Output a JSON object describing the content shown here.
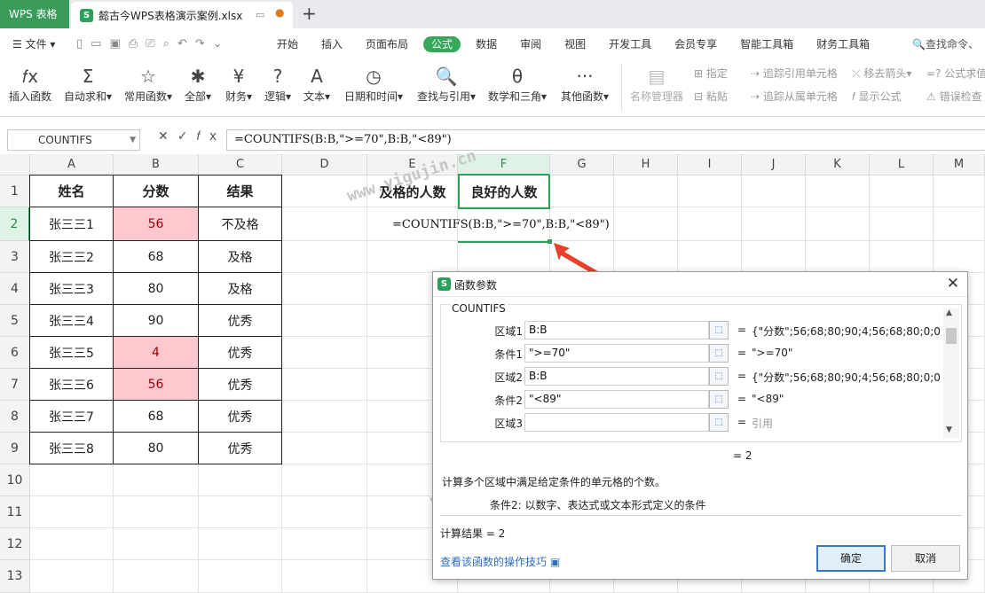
{
  "titlebar": {
    "app_tab": "WPS 表格",
    "doc_tab": "懿古今WPS表格演示案例.xlsx",
    "doc_icon": "S",
    "new_tab": "+"
  },
  "menubar": {
    "file": "☰ 文件 ▾",
    "tabs": [
      "开始",
      "插入",
      "页面布局",
      "公式",
      "数据",
      "审阅",
      "视图",
      "开发工具",
      "会员专享",
      "智能工具箱",
      "财务工具箱"
    ],
    "active_tab": "公式",
    "search": "🔍查找命令、"
  },
  "ribbon": {
    "buttons": [
      {
        "label": "插入函数",
        "icon": "𝑓x"
      },
      {
        "label": "自动求和▾",
        "icon": "Σ"
      },
      {
        "label": "常用函数▾",
        "icon": "☆"
      },
      {
        "label": "全部▾",
        "icon": "✱"
      },
      {
        "label": "财务▾",
        "icon": "¥"
      },
      {
        "label": "逻辑▾",
        "icon": "?"
      },
      {
        "label": "文本▾",
        "icon": "A"
      },
      {
        "label": "日期和时间▾",
        "icon": "◷"
      },
      {
        "label": "查找与引用▾",
        "icon": "🔍"
      },
      {
        "label": "数学和三角▾",
        "icon": "θ"
      },
      {
        "label": "其他函数▾",
        "icon": "···"
      },
      {
        "label": "名称管理器",
        "icon": "▤"
      }
    ],
    "small": {
      "define": "指定",
      "paste": "粘贴",
      "trace_precedents": "追踪引用单元格",
      "trace_dependents": "追踪从属单元格",
      "remove_arrows": "移去箭头▾",
      "show_formulas": "显示公式",
      "eval_formula": "=? 公式求值",
      "error_check": "错误检查"
    }
  },
  "formulabar": {
    "namebox": "COUNTIFS",
    "formula": "=COUNTIFS(B:B,\">=70\",B:B,\"<89\")"
  },
  "sheet": {
    "columns": [
      "A",
      "B",
      "C",
      "D",
      "E",
      "F",
      "G",
      "H",
      "I",
      "J",
      "K",
      "L",
      "M"
    ],
    "rows": [
      "1",
      "2",
      "3",
      "4",
      "5",
      "6",
      "7",
      "8",
      "9",
      "10",
      "11",
      "12",
      "13"
    ],
    "table_headers": [
      "姓名",
      "分数",
      "结果"
    ],
    "table_rows": [
      [
        "张三三1",
        "56",
        "不及格"
      ],
      [
        "张三三2",
        "68",
        "及格"
      ],
      [
        "张三三3",
        "80",
        "及格"
      ],
      [
        "张三三4",
        "90",
        "优秀"
      ],
      [
        "张三三5",
        "4",
        "优秀"
      ],
      [
        "张三三6",
        "56",
        "优秀"
      ],
      [
        "张三三7",
        "68",
        "优秀"
      ],
      [
        "张三三8",
        "80",
        "优秀"
      ]
    ],
    "highlight_color": "#ffc7ce",
    "e1": "及格的人数",
    "f1": "良好的人数",
    "f2_formula": "=COUNTIFS(B:B,\">=70\",B:B,\"<89\")",
    "watermark1": "www.yigujin.cn",
    "watermark2": "www.yigujin.cn"
  },
  "dialog": {
    "title": "函数参数",
    "function_name": "COUNTIFS",
    "args": [
      {
        "label": "区域1",
        "value": "B:B",
        "result": "{\"分数\";56;68;80;90;4;56;68;80;0;0;0..."
      },
      {
        "label": "条件1",
        "value": "\">=70\"",
        "result": "\">=70\""
      },
      {
        "label": "区域2",
        "value": "B:B",
        "result": "{\"分数\";56;68;80;90;4;56;68;80;0;0;0..."
      },
      {
        "label": "条件2",
        "value": "\"<89\"",
        "result": "\"<89\""
      },
      {
        "label": "区域3",
        "value": "",
        "result": "引用"
      }
    ],
    "equals": "=",
    "total": "= 2",
    "description": "计算多个区域中满足给定条件的单元格的个数。",
    "arg_description": "条件2:  以数字、表达式或文本形式定义的条件",
    "result": "计算结果 = 2",
    "help_link": "查看该函数的操作技巧",
    "ok": "确定",
    "cancel": "取消"
  },
  "colors": {
    "accent": "#2aa05a",
    "arrow": "#e8402a"
  }
}
